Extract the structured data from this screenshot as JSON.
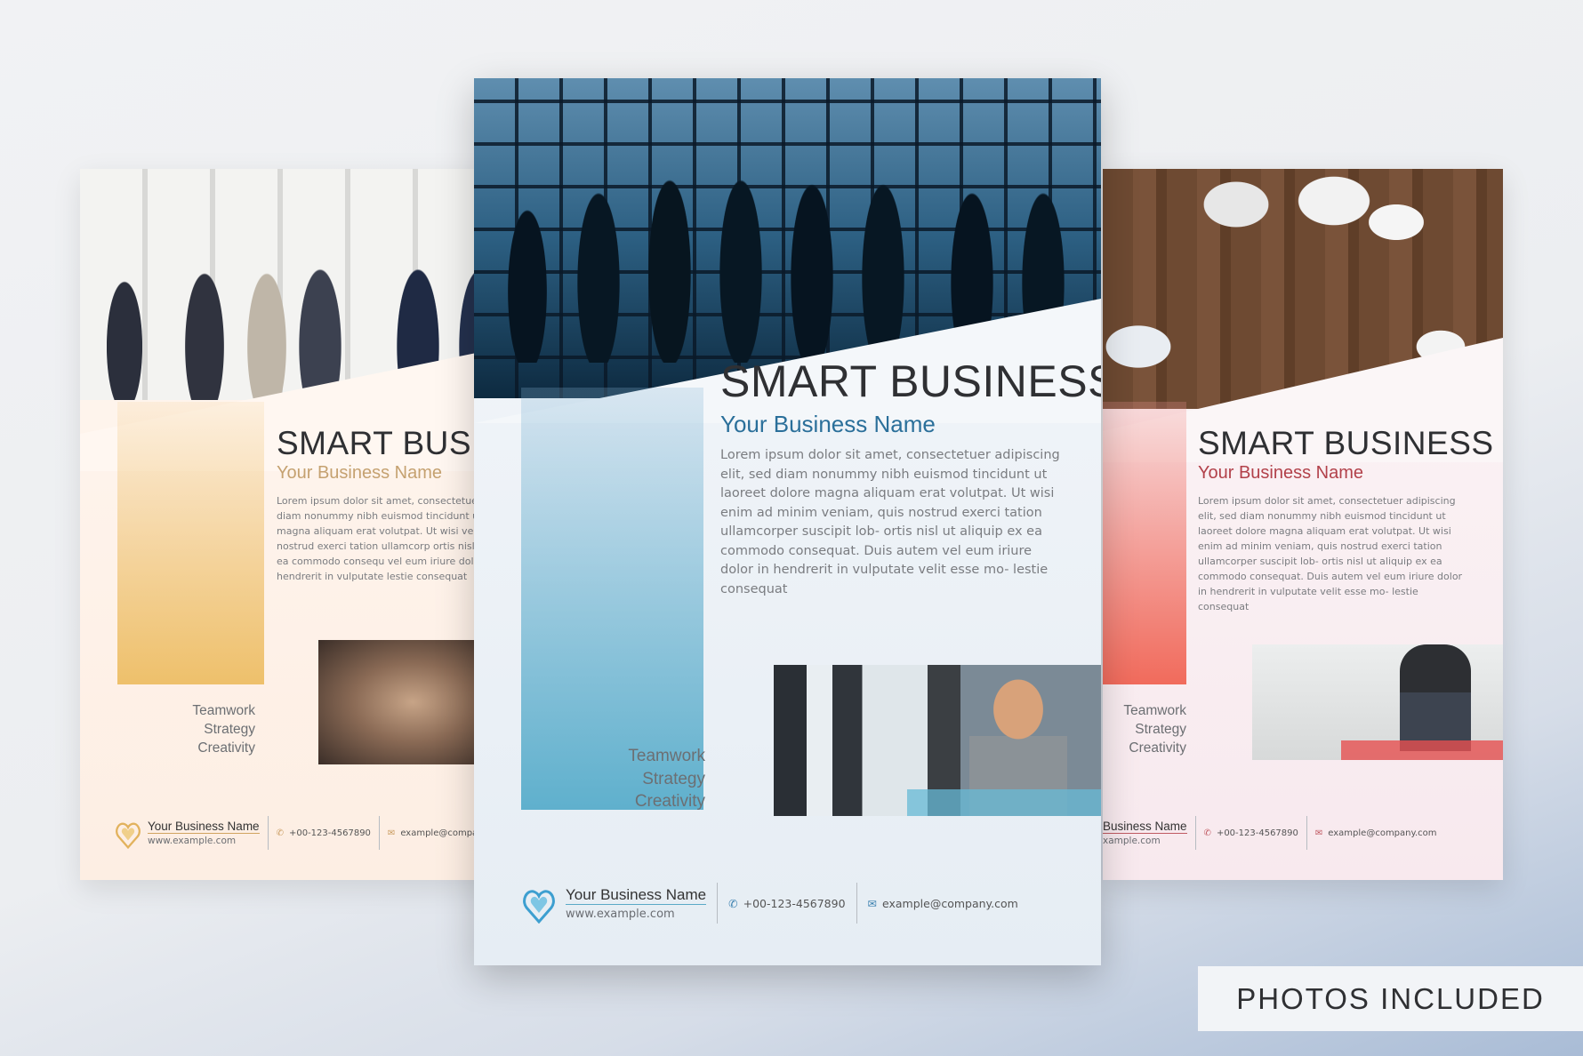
{
  "flyers": {
    "left": {
      "title": "SMART BUSIN",
      "subtitle": "Your Business Name",
      "body": "Lorem ipsum dolor sit amet, consectetuer ad sed diam nonummy nibh euismod tincidunt u dolore magna aliquam erat volutpat. Ut wisi veniam, quis nostrud exerci tation ullamcorp ortis nisl ut aliquip ex ea commodo consequ vel eum iriure dolor in hendrerit in vulputate lestie consequat",
      "skills": [
        "Teamwork",
        "Strategy",
        "Creativity"
      ],
      "footer": {
        "biz_name": "Your Business Name",
        "biz_url": "www.example.com",
        "phone": "+00-123-4567890",
        "email": "example@company.c"
      }
    },
    "center": {
      "title": "SMART BUSINESS",
      "subtitle": "Your Business Name",
      "body": "Lorem ipsum dolor sit amet, consectetuer adipiscing elit, sed diam nonummy nibh euismod tincidunt ut laoreet dolore magna aliquam erat volutpat. Ut wisi enim ad minim veniam, quis nostrud exerci tation ullamcorper suscipit lob- ortis nisl ut aliquip ex ea commodo consequat. Duis autem vel eum iriure dolor in hendrerit in vulputate velit esse mo- lestie consequat",
      "skills": [
        "Teamwork",
        "Strategy",
        "Creativity"
      ],
      "footer": {
        "biz_name": "Your Business Name",
        "biz_url": "www.example.com",
        "phone": "+00-123-4567890",
        "email": "example@company.com"
      }
    },
    "right": {
      "title": "SMART BUSINESS",
      "subtitle": "Your Business Name",
      "body": "Lorem ipsum dolor sit amet, consectetuer adipiscing elit, sed diam nonummy nibh euismod tincidunt ut laoreet dolore magna aliquam erat volutpat. Ut wisi enim ad minim veniam, quis nostrud exerci tation ullamcorper suscipit lob- ortis nisl ut aliquip ex ea commodo consequat. Duis autem vel eum iriure dolor in hendrerit in vulputate velit esse mo- lestie consequat",
      "skills": [
        "Teamwork",
        "Strategy",
        "Creativity"
      ],
      "footer": {
        "biz_name": "Business Name",
        "biz_url": "xample.com",
        "phone": "+00-123-4567890",
        "email": "example@company.com"
      }
    }
  },
  "badge": {
    "label": "PHOTOS INCLUDED"
  },
  "icons": {
    "phone": "phone-icon",
    "email": "envelope-icon",
    "logo": "heart-logo-icon"
  },
  "colors": {
    "blue_accent": "#2a6f9a",
    "orange_accent": "#c5a170",
    "red_accent": "#b2414a"
  }
}
